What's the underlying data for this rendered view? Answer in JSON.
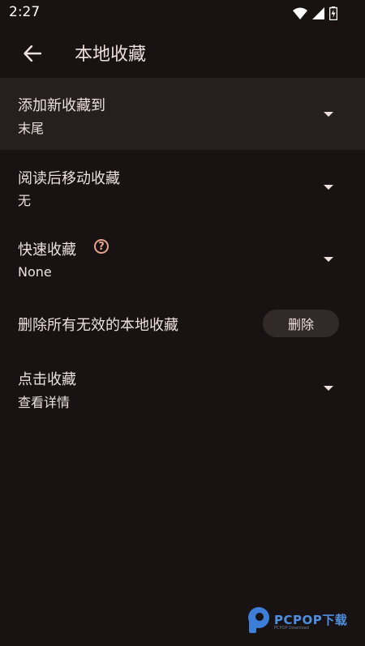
{
  "status_bar": {
    "time": "2:27"
  },
  "app_bar": {
    "title": "本地收藏"
  },
  "settings": {
    "add_new": {
      "title": "添加新收藏到",
      "value": "末尾"
    },
    "move_after_read": {
      "title": "阅读后移动收藏",
      "value": "无"
    },
    "quick_favorite": {
      "title": "快速收藏",
      "help_glyph": "?",
      "value": "None"
    },
    "delete_invalid": {
      "title": "删除所有无效的本地收藏",
      "button_label": "删除"
    },
    "click_favorite": {
      "title": "点击收藏",
      "value": "查看详情"
    }
  },
  "watermark": {
    "brand": "PCPOP下载",
    "sub": "PCPOP Download"
  },
  "colors": {
    "background": "#181312",
    "highlight_row": "#251f1d",
    "accent": "#e8a48c",
    "button_bg": "#322a28",
    "text": "#ede0dd"
  }
}
